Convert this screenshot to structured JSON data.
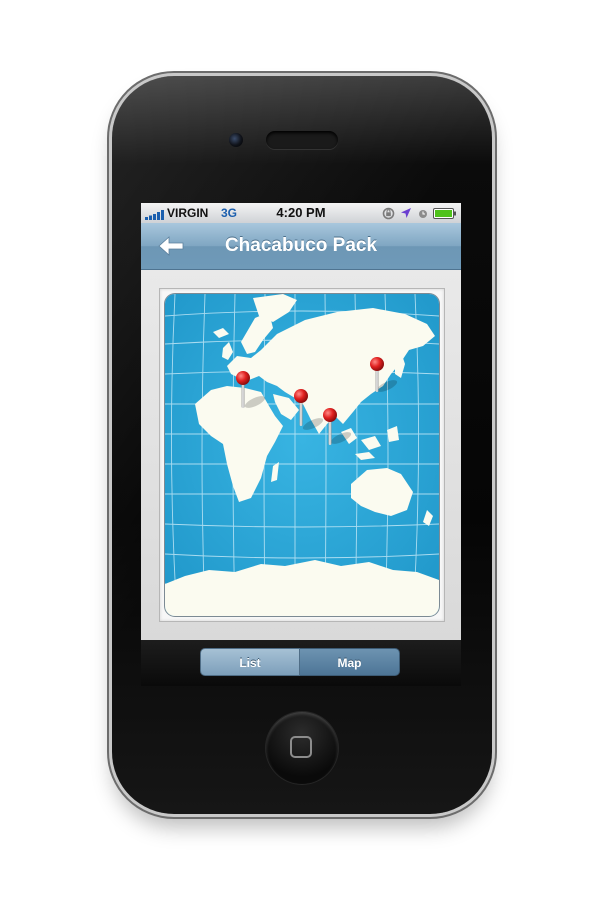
{
  "status_bar": {
    "carrier": "VIRGIN",
    "network": "3G",
    "time": "4:20 PM"
  },
  "nav_bar": {
    "title": "Chacabuco Pack"
  },
  "map": {
    "pins": [
      {
        "name": "map-pin-mediterranean"
      },
      {
        "name": "map-pin-india-west"
      },
      {
        "name": "map-pin-india-east"
      },
      {
        "name": "map-pin-japan"
      }
    ]
  },
  "segmented_control": {
    "list_label": "List",
    "map_label": "Map",
    "selected": "Map"
  },
  "colors": {
    "nav_bar": "#7fa6c2",
    "ocean": "#2aa8d8",
    "land": "#fbfbf0",
    "pin": "#e0201f"
  }
}
